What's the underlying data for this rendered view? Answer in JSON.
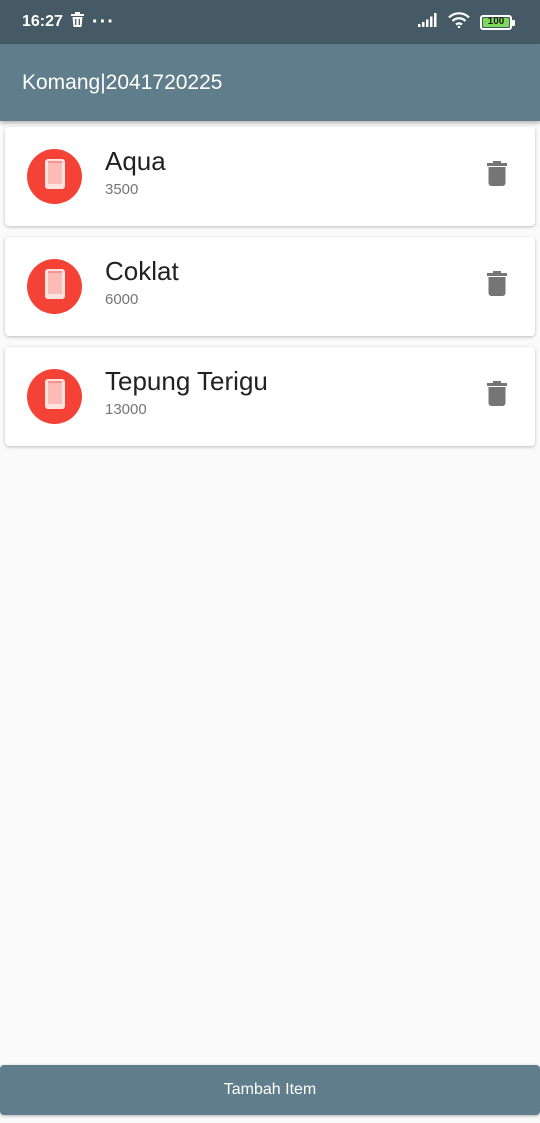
{
  "status_bar": {
    "time": "16:27",
    "dots": "···",
    "battery": "100"
  },
  "app_bar": {
    "title": "Komang|2041720225"
  },
  "items": [
    {
      "name": "Aqua",
      "price": "3500"
    },
    {
      "name": "Coklat",
      "price": "6000"
    },
    {
      "name": "Tepung Terigu",
      "price": "13000"
    }
  ],
  "bottom_button": {
    "label": "Tambah Item"
  },
  "colors": {
    "status_bar": "#455a64",
    "app_bar": "#607d8b",
    "avatar": "#f44336",
    "background": "#fafafa"
  }
}
